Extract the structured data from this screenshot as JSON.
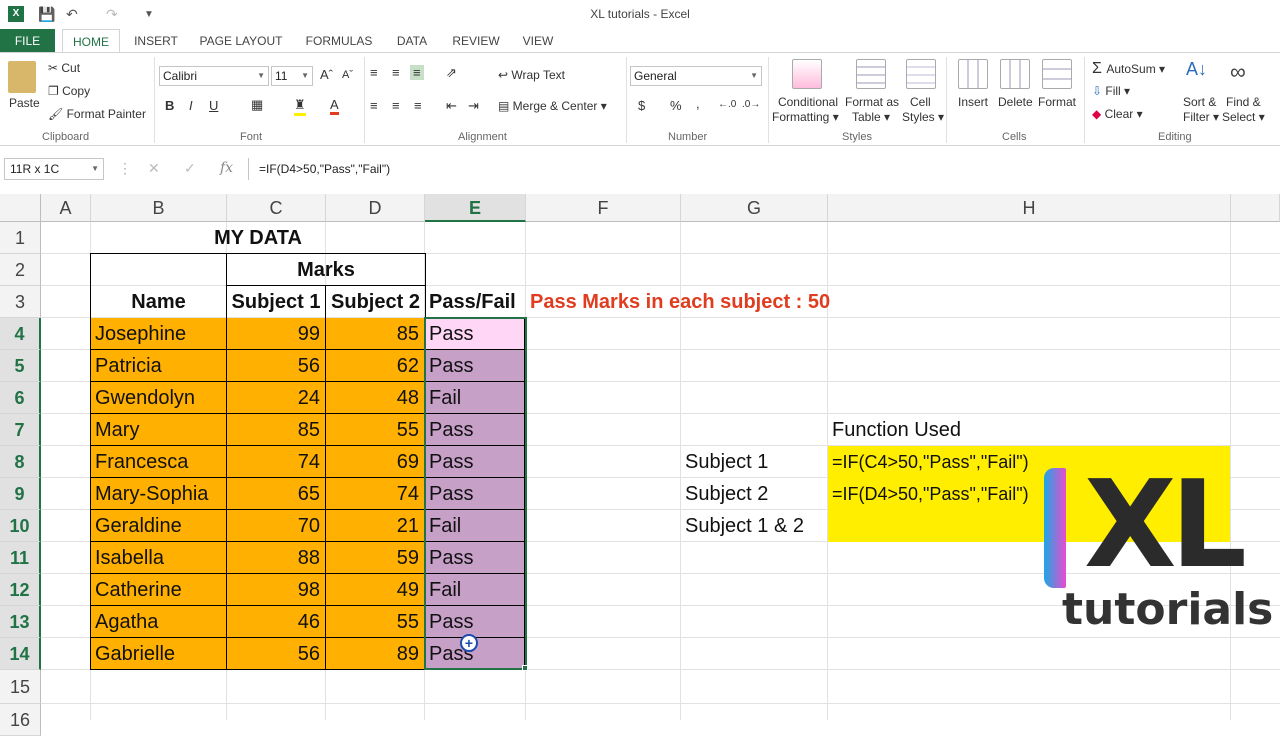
{
  "window": {
    "title": "XL tutorials - Excel"
  },
  "tabs": [
    "FILE",
    "HOME",
    "INSERT",
    "PAGE LAYOUT",
    "FORMULAS",
    "DATA",
    "REVIEW",
    "VIEW"
  ],
  "ribbon": {
    "clipboard": {
      "paste": "Paste",
      "cut": "Cut",
      "copy": "Copy",
      "format_painter": "Format Painter",
      "label": "Clipboard"
    },
    "font": {
      "name": "Calibri",
      "size": "11",
      "bold": "B",
      "italic": "I",
      "underline": "U",
      "label": "Font"
    },
    "alignment": {
      "wrap": "Wrap Text",
      "merge": "Merge & Center",
      "label": "Alignment"
    },
    "number": {
      "format": "General",
      "currency": "$",
      "percent": "%",
      "comma": ",",
      "label": "Number"
    },
    "styles": {
      "conditional1": "Conditional",
      "conditional2": "Formatting",
      "format_table1": "Format as",
      "format_table2": "Table",
      "cell_styles1": "Cell",
      "cell_styles2": "Styles",
      "label": "Styles"
    },
    "cells": {
      "insert": "Insert",
      "delete": "Delete",
      "format": "Format",
      "label": "Cells"
    },
    "editing": {
      "autosum": "AutoSum",
      "fill": "Fill",
      "clear": "Clear",
      "sort1": "Sort &",
      "sort2": "Filter",
      "find1": "Find &",
      "find2": "Select",
      "label": "Editing"
    }
  },
  "formula_bar": {
    "name_box": "11R x 1C",
    "fx": "fx",
    "formula": "=IF(D4>50,\"Pass\",\"Fail\")"
  },
  "columns": [
    "A",
    "B",
    "C",
    "D",
    "E",
    "F",
    "G",
    "H"
  ],
  "rows": [
    "1",
    "2",
    "3",
    "4",
    "5",
    "6",
    "7",
    "8",
    "9",
    "10",
    "11",
    "12",
    "13",
    "14",
    "15",
    "16"
  ],
  "sheet": {
    "title": "MY DATA",
    "marks_header": "Marks",
    "name_header": "Name",
    "subject1_header": "Subject 1",
    "subject2_header": "Subject 2",
    "passfail_header": "Pass/Fail",
    "note": "Pass Marks in each subject : 50",
    "students": [
      {
        "name": "Josephine",
        "s1": "99",
        "s2": "85",
        "result": "Pass"
      },
      {
        "name": "Patricia",
        "s1": "56",
        "s2": "62",
        "result": "Pass"
      },
      {
        "name": "Gwendolyn",
        "s1": "24",
        "s2": "48",
        "result": "Fail"
      },
      {
        "name": "Mary",
        "s1": "85",
        "s2": "55",
        "result": "Pass"
      },
      {
        "name": "Francesca",
        "s1": "74",
        "s2": "69",
        "result": "Pass"
      },
      {
        "name": "Mary-Sophia",
        "s1": "65",
        "s2": "74",
        "result": "Pass"
      },
      {
        "name": "Geraldine",
        "s1": "70",
        "s2": "21",
        "result": "Fail"
      },
      {
        "name": "Isabella",
        "s1": "88",
        "s2": "59",
        "result": "Pass"
      },
      {
        "name": "Catherine",
        "s1": "98",
        "s2": "49",
        "result": "Fail"
      },
      {
        "name": "Agatha",
        "s1": "46",
        "s2": "55",
        "result": "Pass"
      },
      {
        "name": "Gabrielle",
        "s1": "56",
        "s2": "89",
        "result": "Pass"
      }
    ],
    "function_used": "Function Used",
    "g_labels": [
      "Subject 1",
      "Subject 2",
      "Subject 1 & 2"
    ],
    "h_formulas": [
      "=IF(C4>50,\"Pass\",\"Fail\")",
      "=IF(D4>50,\"Pass\",\"Fail\")"
    ]
  },
  "logo": {
    "big": "XL",
    "small": "tutorials"
  },
  "colors": {
    "excel_green": "#217346",
    "orange_fill": "#ffb000",
    "purple_fill": "#c7a0c8",
    "note_red": "#e03c1f",
    "yellow_fill": "#ffee00"
  }
}
